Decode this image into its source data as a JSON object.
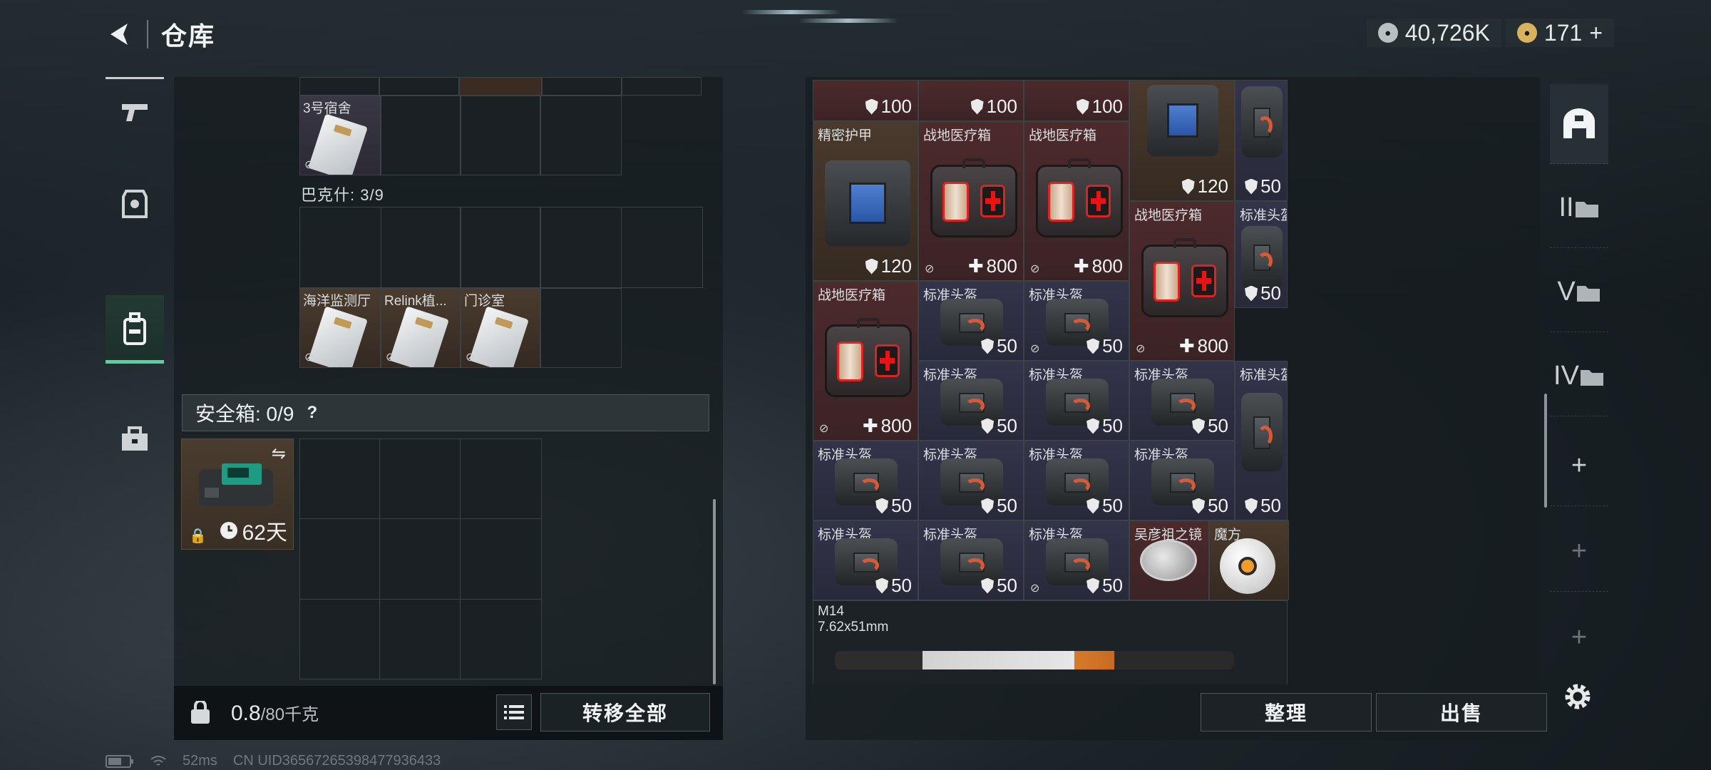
{
  "header": {
    "title": "仓库"
  },
  "currency": {
    "coins": "40,726K",
    "premium": "171",
    "add_icon": "+"
  },
  "left_nav": {
    "items": [
      "pistol-icon",
      "armor-icon",
      "backpack-icon",
      "toolbox-icon"
    ],
    "active_index": 2
  },
  "stash": {
    "top_item": {
      "label": "3号宿舍"
    },
    "backpack_label": "巴克什: 3/9",
    "backpack_items": [
      {
        "label": "海洋监测厅"
      },
      {
        "label": "Relink植..."
      },
      {
        "label": "门诊室"
      }
    ]
  },
  "safe": {
    "label": "安全箱: 0/9",
    "help": "?",
    "days": "62天"
  },
  "footer": {
    "weight_current": "0.8",
    "weight_max": "/80千克",
    "transfer_all": "转移全部"
  },
  "right_grid": {
    "items": [
      {
        "label": "",
        "value": "100",
        "icon": "shield",
        "bg": "red"
      },
      {
        "label": "",
        "value": "100",
        "icon": "shield",
        "bg": "red"
      },
      {
        "label": "",
        "value": "100",
        "icon": "shield",
        "bg": "red"
      },
      {
        "label": "",
        "value": "120",
        "icon": "shield",
        "bg": "brown"
      },
      {
        "label": "",
        "value": "50",
        "icon": "shield",
        "bg": "blue"
      },
      {
        "label": "精密护甲",
        "value": "120",
        "icon": "shield",
        "bg": "brown"
      },
      {
        "label": "战地医疗箱",
        "value": "800",
        "icon": "plus",
        "bg": "red"
      },
      {
        "label": "战地医疗箱",
        "value": "800",
        "icon": "plus",
        "bg": "red"
      },
      {
        "label": "战地医疗箱",
        "value": "800",
        "icon": "plus",
        "bg": "red"
      },
      {
        "label": "标准头盔",
        "value": "50",
        "icon": "shield",
        "bg": "blue"
      },
      {
        "label": "战地医疗箱",
        "value": "800",
        "icon": "plus",
        "bg": "red"
      },
      {
        "label": "标准头盔",
        "value": "50",
        "icon": "shield",
        "bg": "blue"
      },
      {
        "label": "吴彦祖之镜",
        "value": "",
        "icon": "",
        "bg": "red"
      },
      {
        "label": "魔方",
        "value": "",
        "icon": "",
        "bg": "brown"
      }
    ],
    "helmet_label": "标准头盔",
    "helmet_value": "50",
    "weapon": {
      "name": "M14",
      "ammo": "7.62x51mm"
    }
  },
  "actions": {
    "organize": "整理",
    "sell": "出售"
  },
  "right_tabs": {
    "tab2": "II",
    "tab3": "V",
    "tab4": "IV",
    "plus": "+"
  },
  "status_bar": {
    "ping": "52ms",
    "uid": "CN UID36567265398477936433"
  },
  "colors": {
    "accent": "#55d39a",
    "red_bg": "#4d2a2c",
    "brown_bg": "#4a3a2d",
    "blue_bg": "#33344a"
  }
}
